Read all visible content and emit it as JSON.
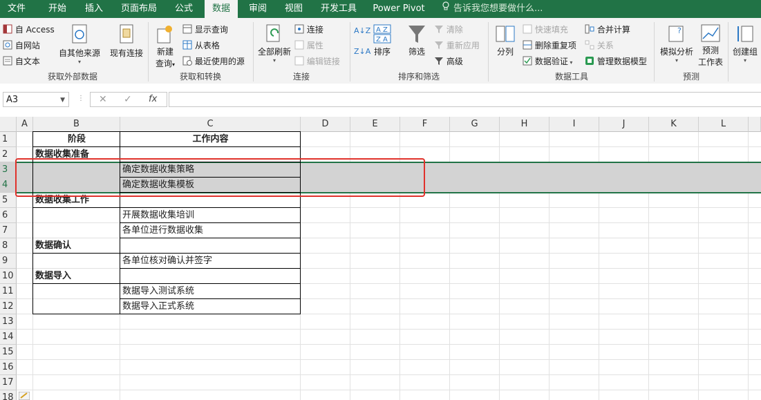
{
  "tabs": [
    "文件",
    "开始",
    "插入",
    "页面布局",
    "公式",
    "数据",
    "审阅",
    "视图",
    "开发工具",
    "Power Pivot"
  ],
  "active_tab": "数据",
  "tell_me": "告诉我您想要做什么...",
  "ribbon": {
    "get_external": {
      "label": "获取外部数据",
      "from_access": "自 Access",
      "from_web": "自网站",
      "from_text": "自文本",
      "from_other": "自其他来源",
      "existing": "现有连接"
    },
    "get_transform": {
      "label": "获取和转换",
      "new_query": "新建",
      "new_query2": "查询",
      "show_query": "显示查询",
      "from_table": "从表格",
      "recent_sources": "最近使用的源"
    },
    "connections": {
      "label": "连接",
      "refresh_all": "全部刷新",
      "connections": "连接",
      "properties": "属性",
      "edit_links": "编辑链接"
    },
    "sort_filter": {
      "label": "排序和筛选",
      "sort": "排序",
      "filter": "筛选",
      "clear": "清除",
      "reapply": "重新应用",
      "advanced": "高级"
    },
    "data_tools": {
      "label": "数据工具",
      "text_to_columns": "分列",
      "flash_fill": "快速填充",
      "remove_dup": "删除重复项",
      "validation": "数据验证",
      "consolidate": "合并计算",
      "relationships": "关系",
      "manage_model": "管理数据模型"
    },
    "forecast": {
      "label": "预测",
      "what_if": "模拟分析",
      "forecast_sheet": "预测",
      "forecast_sheet2": "工作表"
    },
    "outline": {
      "group": "创建组"
    }
  },
  "formula_bar": {
    "name_box": "A3",
    "cancel": "✕",
    "enter": "✓",
    "fx": "fx",
    "formula": ""
  },
  "columns": [
    "A",
    "B",
    "C",
    "D",
    "E",
    "F",
    "G",
    "H",
    "I",
    "J",
    "K",
    "L"
  ],
  "rows": [
    "1",
    "2",
    "3",
    "4",
    "5",
    "6",
    "7",
    "8",
    "9",
    "10",
    "11",
    "12",
    "13",
    "14",
    "15",
    "16",
    "17",
    "18"
  ],
  "cells": {
    "B1": "阶段",
    "C1": "工作内容",
    "B2": "数据收集准备",
    "C3": "确定数据收集策略",
    "C4": "确定数据收集模板",
    "B5": "数据收集工作",
    "C6": "开展数据收集培训",
    "C7": "各单位进行数据收集",
    "B8": "数据确认",
    "C9": "各单位核对确认并签字",
    "B10": "数据导入",
    "C11": "数据导入测试系统",
    "C12": "数据导入正式系统"
  },
  "colors": {
    "ribbon_green": "#217346",
    "highlight_red": "#e0312b",
    "selection_gray": "#d3d3d3"
  }
}
